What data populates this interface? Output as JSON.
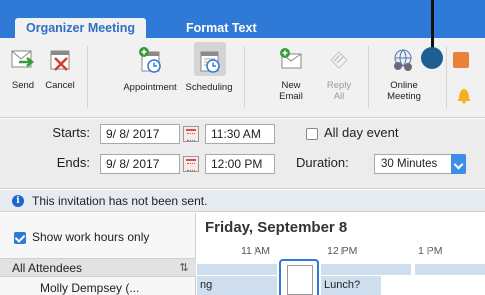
{
  "tabs": [
    {
      "label": "Organizer Meeting",
      "active": true
    },
    {
      "label": "Format Text",
      "active": false
    }
  ],
  "ribbon": {
    "send": "Send",
    "cancel": "Cancel",
    "appointment": "Appointment",
    "scheduling": "Scheduling",
    "new_email": "New\nEmail",
    "reply_all": "Reply\nAll",
    "online_meeting": "Online\nMeeting"
  },
  "form": {
    "starts_label": "Starts:",
    "ends_label": "Ends:",
    "start_date": "9/ 8/ 2017",
    "start_time": "11:30 AM",
    "end_date": "9/ 8/ 2017",
    "end_time": "12:00 PM",
    "all_day_label": "All day event",
    "duration_label": "Duration:",
    "duration_value": "30 Minutes"
  },
  "info_bar": {
    "icon": "info-icon",
    "text": "This invitation has not been sent."
  },
  "schedule": {
    "show_work_hours": "Show work hours only",
    "all_attendees": "All Attendees",
    "attendee_1": "Molly Dempsey (...",
    "day_title": "Friday, September 8",
    "hours": [
      "11 AM",
      "12 PM",
      "1 PM"
    ],
    "busy_left_fragment": "ng",
    "busy_lunch": "Lunch?"
  },
  "colors": {
    "ribbon_accent": "#2f7ad6",
    "callout_dot": "#1f5e94",
    "busy_fill": "#cfdeee"
  }
}
